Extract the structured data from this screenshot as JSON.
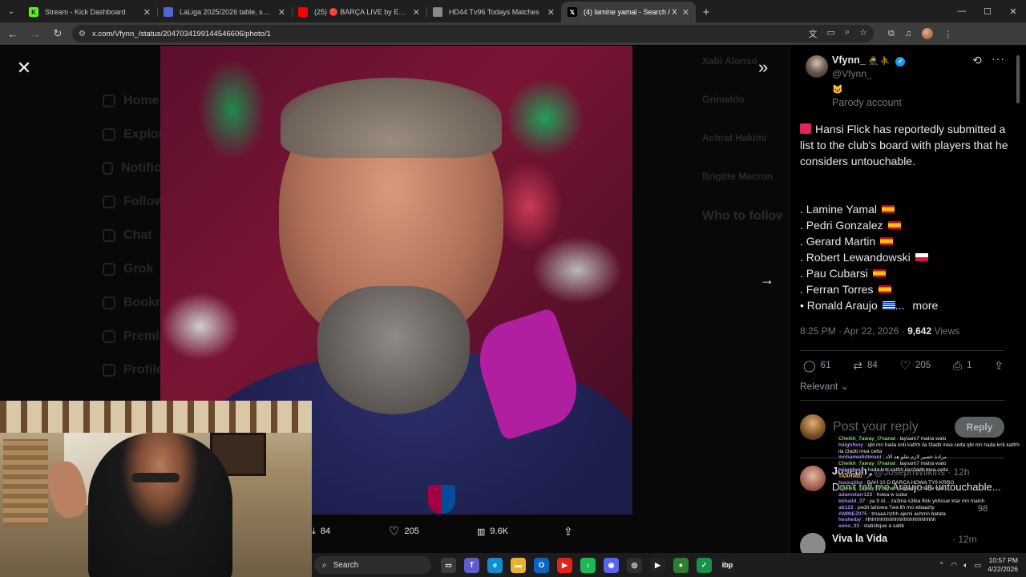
{
  "browser": {
    "tabs": [
      {
        "title": "Stream - Kick Dashboard",
        "icon": "kick-icon",
        "color": "#53fc18",
        "active": false
      },
      {
        "title": "LaLiga 2025/2026 table, schedu",
        "icon": "laliga-icon",
        "color": "#4f66d8",
        "active": false
      },
      {
        "title": "(25) 🔴 BARÇA LIVE by ESTREL",
        "icon": "youtube-icon",
        "color": "#ff0000",
        "active": false
      },
      {
        "title": "HD44 Tv96 Todays Matches",
        "icon": "globe-icon",
        "color": "#8a8a8a",
        "active": false
      },
      {
        "title": "(4) lamine yamal - Search / X",
        "icon": "x-icon",
        "color": "#ffffff",
        "active": true
      }
    ],
    "url": "x.com/Vfynn_/status/2047034199144546606/photo/1"
  },
  "media": {
    "replies": "84",
    "likes": "205",
    "views": "9.6K"
  },
  "ghost": {
    "nav": [
      "Home",
      "Explore",
      "Notifications",
      "Follow",
      "Chat",
      "Grok",
      "Bookmarks",
      "Premium",
      "Profile"
    ],
    "right": [
      "Xabi Alonso",
      "Grimaldo",
      "Achraf Hakimi",
      "Brigitte Macron"
    ],
    "who_to_follow": "Who to follow"
  },
  "tweet": {
    "name": "Vfynn_",
    "name_suffix": "🥷 ⛹",
    "handle": "@Vfynn_",
    "badge": "🐱",
    "parody": "Parody account",
    "body": "Hansi Flick has reportedly submitted a list to the club's board with players that he considers untouchable.",
    "players": [
      {
        "text": ". Lamine Yamal",
        "flag": "es"
      },
      {
        "text": ". Pedri Gonzalez",
        "flag": "es"
      },
      {
        "text": ". Gerard Martin",
        "flag": "es"
      },
      {
        "text": ". Robert Lewandowski",
        "flag": "pl"
      },
      {
        "text": ". Pau Cubarsi",
        "flag": "es"
      },
      {
        "text": ". Ferran Torres",
        "flag": "es"
      },
      {
        "text": "• Ronald Araujo",
        "flag": "uy"
      }
    ],
    "ellipsis": "...",
    "more": "more",
    "time": "8:25 PM · Apr 22, 2026 ·",
    "views": "9,642",
    "views_label": "Views",
    "replies": "61",
    "reposts": "84",
    "likes": "205",
    "bookmarks": "1",
    "relevant": "Relevant",
    "reply_placeholder": "Post your reply",
    "reply_button": "Reply"
  },
  "replies": [
    {
      "name": "Joseph",
      "handle": "@JosephWilkins · 12h",
      "text": "Don't tell me Araujo is untouchable...",
      "count": "98"
    },
    {
      "name": "Viva la Vida",
      "handle": "· 12m"
    }
  ],
  "chat": [
    {
      "user": "Cheikh_7away_l7nanat",
      "text": "laysam7 matra walo",
      "color": "g"
    },
    {
      "user": "hiiighfony",
      "text": "qbl mn hada knti katfrh ila t3adti mea celta qbl mn hada knti katfrh ila t3adti mea celta",
      "color": ""
    },
    {
      "user": "mohamedidimani",
      "text": "مرادة خصير لازم نقلو هد الاد",
      "color": ""
    },
    {
      "user": "Cheikh_7away_l7nanat",
      "text": "laysam7 matra walo",
      "color": "g"
    },
    {
      "user": "hiiighfony",
      "text": "hada knti katfrh ila t3adti mea celta",
      "color": ""
    },
    {
      "user": "TAAHA20",
      "text": "🎤",
      "color": "y"
    },
    {
      "user": "huuuzilist",
      "text": "RAH 10 D BARCA HOWA TY9 KRRO",
      "color": ""
    },
    {
      "user": "Cheikh_7away_l7nanat",
      "text": "laysam7 matra walo",
      "color": "g"
    },
    {
      "user": "adamstarr123",
      "text": "howa w cuba",
      "color": ""
    },
    {
      "user": "kkhalid_37",
      "text": "ya 9 ot... za3ma s3iba flick ykhssar ktar mn match",
      "color": ""
    },
    {
      "user": "ab123",
      "text": "pedri tahowa 7wa lih mo wbaazty",
      "color": ""
    },
    {
      "user": "AMINEZ075",
      "text": "tmaaa hzhh ajemi achmn batata",
      "color": ""
    },
    {
      "user": "hesheiby",
      "text": "Hhhhhhhhhhhhhhhhhhhhhhhh",
      "color": ""
    },
    {
      "user": "xeno_33",
      "text": "statistique a sahb",
      "color": ""
    }
  ],
  "taskbar": {
    "search": "Search",
    "apps": [
      {
        "name": "task-view-icon",
        "color": "#3a3a3a",
        "glyph": "▭"
      },
      {
        "name": "teams-icon",
        "color": "#5b5fc7",
        "glyph": "T"
      },
      {
        "name": "edge-icon",
        "color": "#0f8ed6",
        "glyph": "e"
      },
      {
        "name": "file-explorer-icon",
        "color": "#e8b430",
        "glyph": "▬"
      },
      {
        "name": "outlook-icon",
        "color": "#0a64c2",
        "glyph": "O"
      },
      {
        "name": "youtube-icon",
        "color": "#e62117",
        "glyph": "▶"
      },
      {
        "name": "spotify-icon",
        "color": "#1db954",
        "glyph": "♪"
      },
      {
        "name": "discord-icon",
        "color": "#5865f2",
        "glyph": "◉"
      },
      {
        "name": "obs-icon",
        "color": "#2e2e2e",
        "glyph": "◎"
      },
      {
        "name": "kick-icon",
        "color": "#222",
        "glyph": "▶"
      },
      {
        "name": "chrome-icon",
        "color": "#2e7d32",
        "glyph": "●"
      },
      {
        "name": "check-app-icon",
        "color": "#1a8f4a",
        "glyph": "✓"
      },
      {
        "name": "ibp-icon",
        "color": "#202020",
        "glyph": "ibp"
      }
    ],
    "time": "10:57 PM",
    "date": "4/22/2026"
  }
}
